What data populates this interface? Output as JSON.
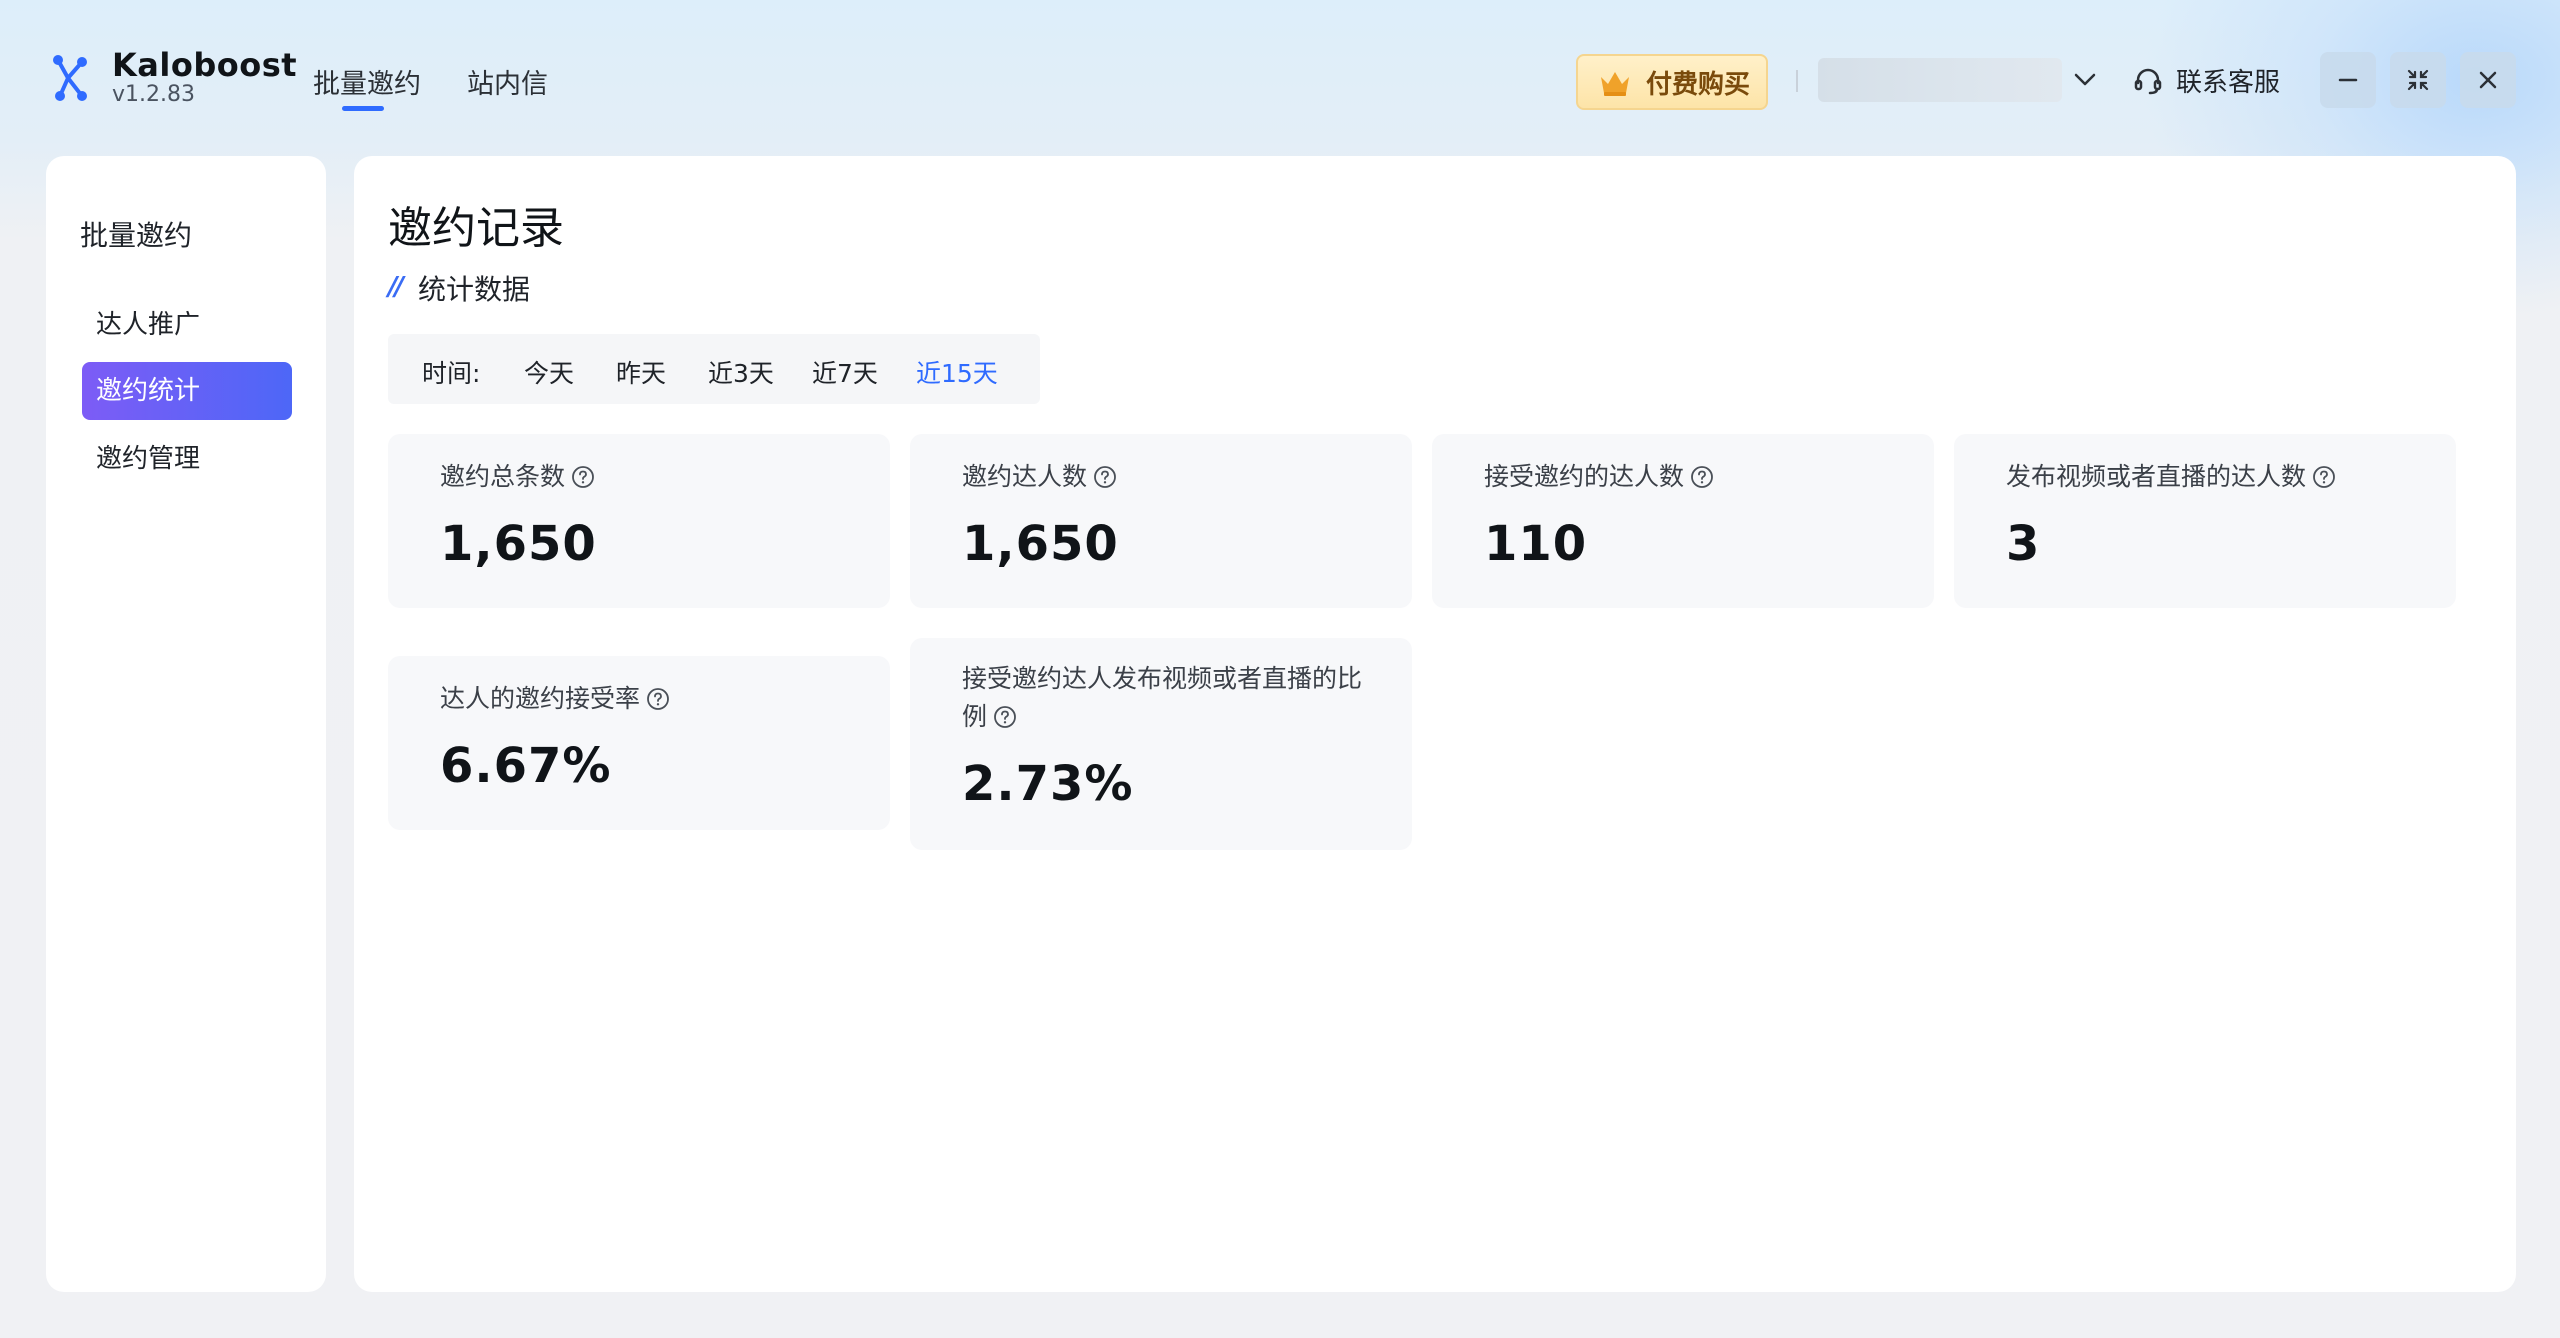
{
  "app": {
    "name": "Kaloboost",
    "version": "v1.2.83"
  },
  "nav": {
    "tabs": [
      {
        "label": "批量邀约",
        "active": true
      },
      {
        "label": "站内信",
        "active": false
      }
    ]
  },
  "header": {
    "pay_label": "付费购买",
    "support_label": "联系客服",
    "icons": {
      "logo": "kaloboost-logo",
      "crown": "crown-icon",
      "chevron": "chevron-down-icon",
      "support": "headset-icon",
      "minimize": "minimize-icon",
      "maximize": "collapse-icon",
      "close": "close-icon"
    }
  },
  "sidebar": {
    "title": "批量邀约",
    "items": [
      {
        "label": "达人推广",
        "active": false
      },
      {
        "label": "邀约统计",
        "active": true
      },
      {
        "label": "邀约管理",
        "active": false
      }
    ]
  },
  "main": {
    "title": "邀约记录",
    "section_mark": "//",
    "section_title": "统计数据",
    "time_filter": {
      "label": "时间:",
      "options": [
        "今天",
        "昨天",
        "近3天",
        "近7天",
        "近15天"
      ],
      "selected": "近15天"
    },
    "stats": [
      {
        "label": "邀约总条数",
        "value": "1,650"
      },
      {
        "label": "邀约达人数",
        "value": "1,650"
      },
      {
        "label": "接受邀约的达人数",
        "value": "110"
      },
      {
        "label": "发布视频或者直播的达人数",
        "value": "3"
      },
      {
        "label": "达人的邀约接受率",
        "value": "6.67%"
      },
      {
        "label_line1": "接受邀约达人发布视频或者直播的比",
        "label_line2": "例",
        "value": "2.73%"
      }
    ]
  },
  "colors": {
    "accent": "#2f6bff",
    "active_item_gradient_start": "#7d5cf6",
    "active_item_gradient_end": "#4d67f7",
    "pay_button_bg": "#fde4a8"
  }
}
